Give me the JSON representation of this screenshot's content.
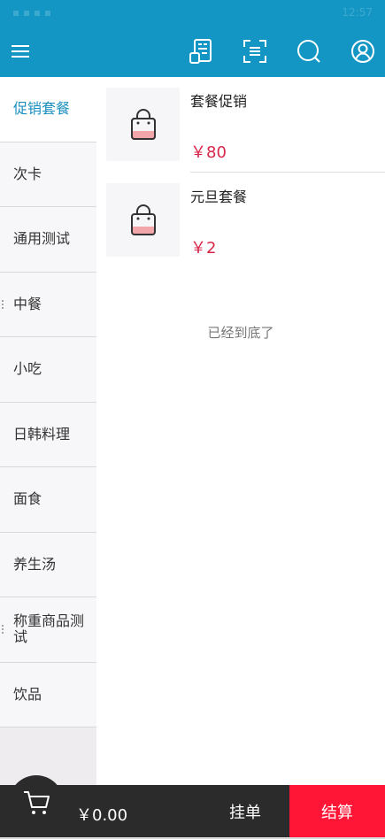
{
  "header": {
    "status_time": "12:57",
    "icons": [
      "menu-icon",
      "order-list-icon",
      "scan-icon",
      "search-icon",
      "user-icon"
    ]
  },
  "sidebar": {
    "items": [
      {
        "label": "促销套餐",
        "active": true
      },
      {
        "label": "次卡"
      },
      {
        "label": "通用测试"
      },
      {
        "label": "中餐"
      },
      {
        "label": "小吃"
      },
      {
        "label": "日韩料理"
      },
      {
        "label": "面食"
      },
      {
        "label": "养生汤"
      },
      {
        "label": "称重商品测试"
      },
      {
        "label": "饮品"
      }
    ]
  },
  "products": [
    {
      "name": "套餐促销",
      "price": "￥80",
      "icon": "bag-icon"
    },
    {
      "name": "元旦套餐",
      "price": "￥2",
      "icon": "bag-icon"
    }
  ],
  "list_end": "已经到底了",
  "bottom": {
    "total": "￥0.00",
    "hold_label": "挂单",
    "checkout_label": "结算"
  },
  "colors": {
    "header": "#1396c4",
    "active_category": "#1a8fbf",
    "price": "#d8284a",
    "checkout": "#ff1535",
    "bottom_bar": "#2b2b2b"
  }
}
